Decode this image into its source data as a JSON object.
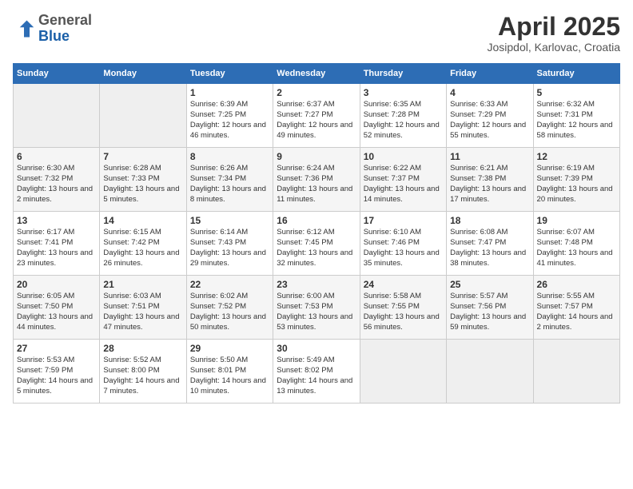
{
  "header": {
    "logo_line1": "General",
    "logo_line2": "Blue",
    "title": "April 2025",
    "subtitle": "Josipdol, Karlovac, Croatia"
  },
  "weekdays": [
    "Sunday",
    "Monday",
    "Tuesday",
    "Wednesday",
    "Thursday",
    "Friday",
    "Saturday"
  ],
  "weeks": [
    [
      {
        "day": "",
        "sunrise": "",
        "sunset": "",
        "daylight": ""
      },
      {
        "day": "",
        "sunrise": "",
        "sunset": "",
        "daylight": ""
      },
      {
        "day": "1",
        "sunrise": "Sunrise: 6:39 AM",
        "sunset": "Sunset: 7:25 PM",
        "daylight": "Daylight: 12 hours and 46 minutes."
      },
      {
        "day": "2",
        "sunrise": "Sunrise: 6:37 AM",
        "sunset": "Sunset: 7:27 PM",
        "daylight": "Daylight: 12 hours and 49 minutes."
      },
      {
        "day": "3",
        "sunrise": "Sunrise: 6:35 AM",
        "sunset": "Sunset: 7:28 PM",
        "daylight": "Daylight: 12 hours and 52 minutes."
      },
      {
        "day": "4",
        "sunrise": "Sunrise: 6:33 AM",
        "sunset": "Sunset: 7:29 PM",
        "daylight": "Daylight: 12 hours and 55 minutes."
      },
      {
        "day": "5",
        "sunrise": "Sunrise: 6:32 AM",
        "sunset": "Sunset: 7:31 PM",
        "daylight": "Daylight: 12 hours and 58 minutes."
      }
    ],
    [
      {
        "day": "6",
        "sunrise": "Sunrise: 6:30 AM",
        "sunset": "Sunset: 7:32 PM",
        "daylight": "Daylight: 13 hours and 2 minutes."
      },
      {
        "day": "7",
        "sunrise": "Sunrise: 6:28 AM",
        "sunset": "Sunset: 7:33 PM",
        "daylight": "Daylight: 13 hours and 5 minutes."
      },
      {
        "day": "8",
        "sunrise": "Sunrise: 6:26 AM",
        "sunset": "Sunset: 7:34 PM",
        "daylight": "Daylight: 13 hours and 8 minutes."
      },
      {
        "day": "9",
        "sunrise": "Sunrise: 6:24 AM",
        "sunset": "Sunset: 7:36 PM",
        "daylight": "Daylight: 13 hours and 11 minutes."
      },
      {
        "day": "10",
        "sunrise": "Sunrise: 6:22 AM",
        "sunset": "Sunset: 7:37 PM",
        "daylight": "Daylight: 13 hours and 14 minutes."
      },
      {
        "day": "11",
        "sunrise": "Sunrise: 6:21 AM",
        "sunset": "Sunset: 7:38 PM",
        "daylight": "Daylight: 13 hours and 17 minutes."
      },
      {
        "day": "12",
        "sunrise": "Sunrise: 6:19 AM",
        "sunset": "Sunset: 7:39 PM",
        "daylight": "Daylight: 13 hours and 20 minutes."
      }
    ],
    [
      {
        "day": "13",
        "sunrise": "Sunrise: 6:17 AM",
        "sunset": "Sunset: 7:41 PM",
        "daylight": "Daylight: 13 hours and 23 minutes."
      },
      {
        "day": "14",
        "sunrise": "Sunrise: 6:15 AM",
        "sunset": "Sunset: 7:42 PM",
        "daylight": "Daylight: 13 hours and 26 minutes."
      },
      {
        "day": "15",
        "sunrise": "Sunrise: 6:14 AM",
        "sunset": "Sunset: 7:43 PM",
        "daylight": "Daylight: 13 hours and 29 minutes."
      },
      {
        "day": "16",
        "sunrise": "Sunrise: 6:12 AM",
        "sunset": "Sunset: 7:45 PM",
        "daylight": "Daylight: 13 hours and 32 minutes."
      },
      {
        "day": "17",
        "sunrise": "Sunrise: 6:10 AM",
        "sunset": "Sunset: 7:46 PM",
        "daylight": "Daylight: 13 hours and 35 minutes."
      },
      {
        "day": "18",
        "sunrise": "Sunrise: 6:08 AM",
        "sunset": "Sunset: 7:47 PM",
        "daylight": "Daylight: 13 hours and 38 minutes."
      },
      {
        "day": "19",
        "sunrise": "Sunrise: 6:07 AM",
        "sunset": "Sunset: 7:48 PM",
        "daylight": "Daylight: 13 hours and 41 minutes."
      }
    ],
    [
      {
        "day": "20",
        "sunrise": "Sunrise: 6:05 AM",
        "sunset": "Sunset: 7:50 PM",
        "daylight": "Daylight: 13 hours and 44 minutes."
      },
      {
        "day": "21",
        "sunrise": "Sunrise: 6:03 AM",
        "sunset": "Sunset: 7:51 PM",
        "daylight": "Daylight: 13 hours and 47 minutes."
      },
      {
        "day": "22",
        "sunrise": "Sunrise: 6:02 AM",
        "sunset": "Sunset: 7:52 PM",
        "daylight": "Daylight: 13 hours and 50 minutes."
      },
      {
        "day": "23",
        "sunrise": "Sunrise: 6:00 AM",
        "sunset": "Sunset: 7:53 PM",
        "daylight": "Daylight: 13 hours and 53 minutes."
      },
      {
        "day": "24",
        "sunrise": "Sunrise: 5:58 AM",
        "sunset": "Sunset: 7:55 PM",
        "daylight": "Daylight: 13 hours and 56 minutes."
      },
      {
        "day": "25",
        "sunrise": "Sunrise: 5:57 AM",
        "sunset": "Sunset: 7:56 PM",
        "daylight": "Daylight: 13 hours and 59 minutes."
      },
      {
        "day": "26",
        "sunrise": "Sunrise: 5:55 AM",
        "sunset": "Sunset: 7:57 PM",
        "daylight": "Daylight: 14 hours and 2 minutes."
      }
    ],
    [
      {
        "day": "27",
        "sunrise": "Sunrise: 5:53 AM",
        "sunset": "Sunset: 7:59 PM",
        "daylight": "Daylight: 14 hours and 5 minutes."
      },
      {
        "day": "28",
        "sunrise": "Sunrise: 5:52 AM",
        "sunset": "Sunset: 8:00 PM",
        "daylight": "Daylight: 14 hours and 7 minutes."
      },
      {
        "day": "29",
        "sunrise": "Sunrise: 5:50 AM",
        "sunset": "Sunset: 8:01 PM",
        "daylight": "Daylight: 14 hours and 10 minutes."
      },
      {
        "day": "30",
        "sunrise": "Sunrise: 5:49 AM",
        "sunset": "Sunset: 8:02 PM",
        "daylight": "Daylight: 14 hours and 13 minutes."
      },
      {
        "day": "",
        "sunrise": "",
        "sunset": "",
        "daylight": ""
      },
      {
        "day": "",
        "sunrise": "",
        "sunset": "",
        "daylight": ""
      },
      {
        "day": "",
        "sunrise": "",
        "sunset": "",
        "daylight": ""
      }
    ]
  ]
}
